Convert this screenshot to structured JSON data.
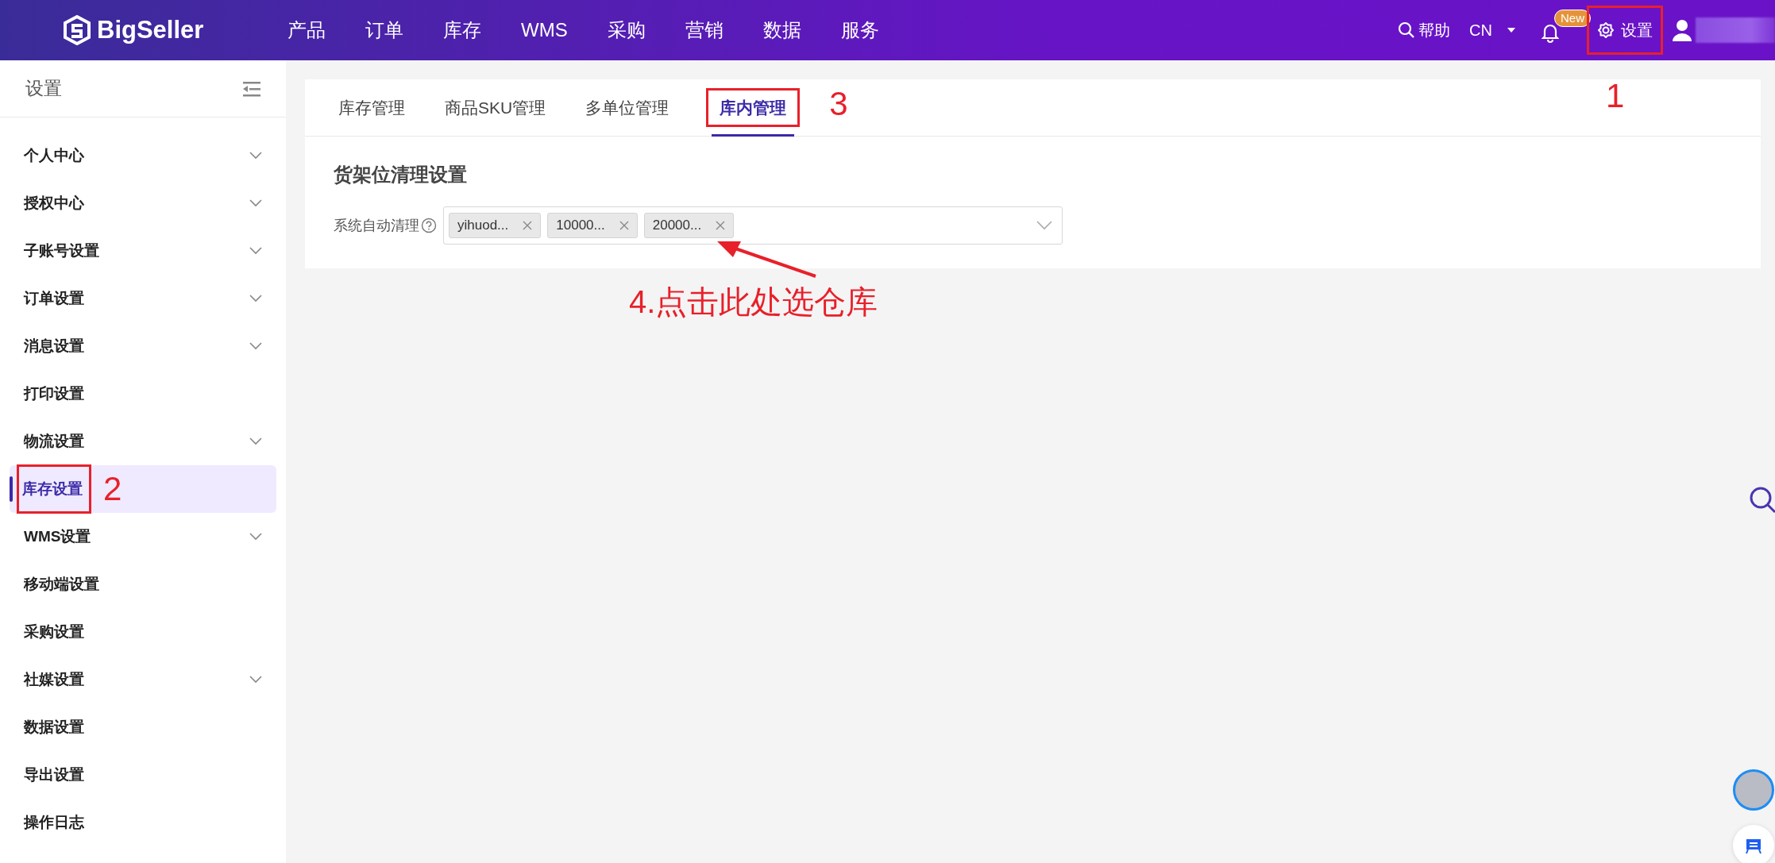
{
  "header": {
    "logo": "BigSeller",
    "nav": [
      "产品",
      "订单",
      "库存",
      "WMS",
      "采购",
      "营销",
      "数据",
      "服务"
    ],
    "help": "帮助",
    "language": "CN",
    "notification_badge": "New",
    "settings": {
      "label": "设置",
      "highlighted": true,
      "step": "1"
    }
  },
  "sidebar": {
    "title": "设置",
    "items": [
      {
        "label": "个人中心",
        "expandable": true,
        "selected": false,
        "highlighted": false
      },
      {
        "label": "授权中心",
        "expandable": true,
        "selected": false,
        "highlighted": false
      },
      {
        "label": "子账号设置",
        "expandable": true,
        "selected": false,
        "highlighted": false
      },
      {
        "label": "订单设置",
        "expandable": true,
        "selected": false,
        "highlighted": false
      },
      {
        "label": "消息设置",
        "expandable": true,
        "selected": false,
        "highlighted": false
      },
      {
        "label": "打印设置",
        "expandable": false,
        "selected": false,
        "highlighted": false
      },
      {
        "label": "物流设置",
        "expandable": true,
        "selected": false,
        "highlighted": false
      },
      {
        "label": "库存设置",
        "expandable": false,
        "selected": true,
        "highlighted": true,
        "step": "2"
      },
      {
        "label": "WMS设置",
        "expandable": true,
        "selected": false,
        "highlighted": false
      },
      {
        "label": "移动端设置",
        "expandable": false,
        "selected": false,
        "highlighted": false
      },
      {
        "label": "采购设置",
        "expandable": false,
        "selected": false,
        "highlighted": false
      },
      {
        "label": "社媒设置",
        "expandable": true,
        "selected": false,
        "highlighted": false
      },
      {
        "label": "数据设置",
        "expandable": false,
        "selected": false,
        "highlighted": false
      },
      {
        "label": "导出设置",
        "expandable": false,
        "selected": false,
        "highlighted": false
      },
      {
        "label": "操作日志",
        "expandable": false,
        "selected": false,
        "highlighted": false
      }
    ]
  },
  "tabs": [
    {
      "label": "库存管理",
      "selected": false,
      "highlighted": false
    },
    {
      "label": "商品SKU管理",
      "selected": false,
      "highlighted": false
    },
    {
      "label": "多单位管理",
      "selected": false,
      "highlighted": false
    },
    {
      "label": "库内管理",
      "selected": true,
      "highlighted": true,
      "step": "3"
    }
  ],
  "section": {
    "title": "货架位清理设置",
    "field": {
      "label": "系统自动清理",
      "tags": [
        "yihuod...",
        "10000...",
        "20000..."
      ]
    }
  },
  "callout": {
    "text": "4.点击此处选仓库"
  }
}
